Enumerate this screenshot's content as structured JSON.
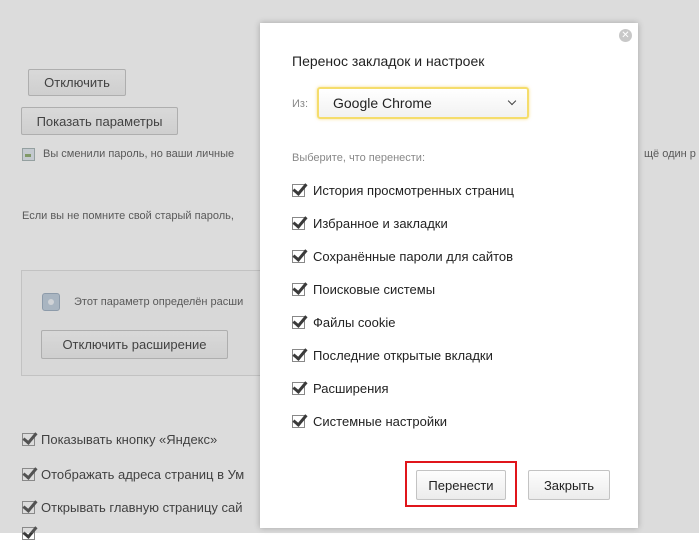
{
  "background": {
    "disable_button": "Отключить",
    "show_params_button": "Показать параметры",
    "password_notice_left": "Вы сменили пароль, но ваши личные",
    "password_notice_right": "щё один р",
    "forgot_password_text": "Если вы не помните свой старый пароль,",
    "extension_notice": "Этот параметр определён расши",
    "disable_extension_button": "Отключить расширение",
    "checkboxes": [
      {
        "label": "Показывать кнопку «Яндекс»",
        "checked": true
      },
      {
        "label": "Отображать адреса страниц в Ум",
        "checked": true
      },
      {
        "label": "Открывать главную страницу сай",
        "checked": true
      }
    ]
  },
  "dialog": {
    "title": "Перенос закладок и настроек",
    "from_label": "Из:",
    "source_browser": "Google Chrome",
    "choose_label": "Выберите, что перенести:",
    "options": [
      {
        "label": "История просмотренных страниц",
        "checked": true
      },
      {
        "label": "Избранное и закладки",
        "checked": true
      },
      {
        "label": "Сохранённые пароли для сайтов",
        "checked": true
      },
      {
        "label": "Поисковые системы",
        "checked": true
      },
      {
        "label": "Файлы cookie",
        "checked": true
      },
      {
        "label": "Последние открытые вкладки",
        "checked": true
      },
      {
        "label": "Расширения",
        "checked": true
      },
      {
        "label": "Системные настройки",
        "checked": true
      }
    ],
    "transfer_button": "Перенести",
    "close_button": "Закрыть",
    "close_icon": "close-icon",
    "highlight_color": "#e0151b",
    "select_focus_color": "#f5dd6c"
  }
}
